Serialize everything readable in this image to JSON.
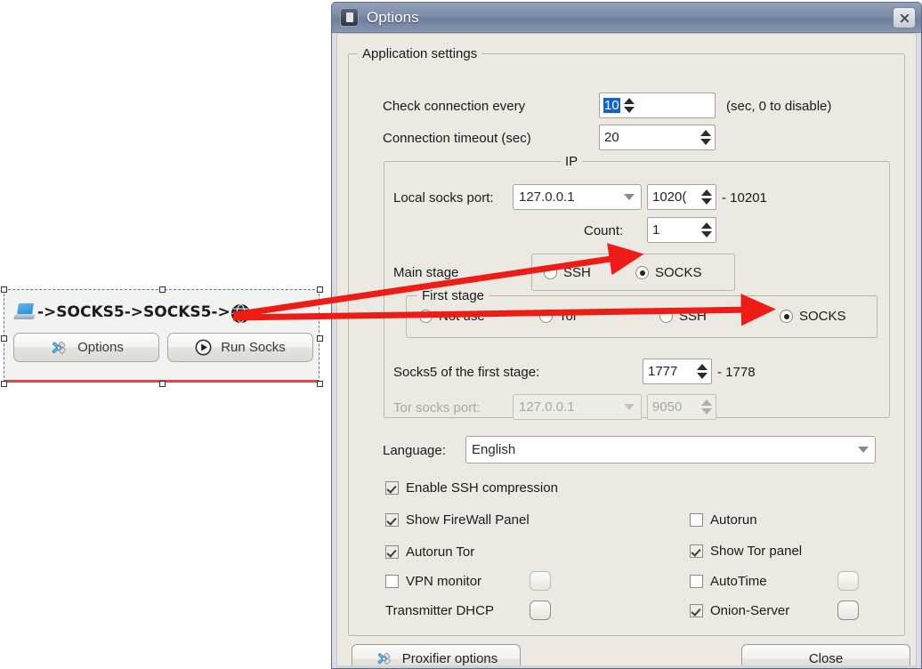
{
  "widget": {
    "chain_text": "->SOCKS5->SOCKS5->",
    "pc_icon": "computer-icon",
    "globe_icon": "globe-icon",
    "options_label": "Options",
    "options_icon": "tools-icon",
    "run_label": "Run Socks",
    "run_icon": "play-icon"
  },
  "dialog": {
    "title": "Options",
    "title_icon": "app-icon",
    "close_icon": "close-icon",
    "group_legend": "Application settings",
    "check_connection_label": "Check connection every",
    "check_connection_value": "10",
    "check_connection_hint": "(sec, 0 to disable)",
    "connection_timeout_label": "Connection timeout (sec)",
    "connection_timeout_value": "20",
    "ip_group": {
      "legend": "IP",
      "local_socks_label": "Local socks port:",
      "local_socks_ip": "127.0.0.1",
      "port_value": "1020(",
      "port_range_suffix": "- 10201",
      "count_label": "Count:",
      "count_value": "1"
    },
    "main_stage": {
      "label": "Main stage",
      "options": [
        {
          "label": "SSH",
          "selected": false
        },
        {
          "label": "SOCKS",
          "selected": true
        }
      ]
    },
    "first_stage": {
      "legend": "First stage",
      "options": [
        {
          "label": "Not use",
          "selected": false
        },
        {
          "label": "Tor",
          "selected": false
        },
        {
          "label": "SSH",
          "selected": false
        },
        {
          "label": "SOCKS",
          "selected": true
        }
      ]
    },
    "socks5_first_stage": {
      "label": "Socks5 of the first stage:",
      "value": "1777",
      "range_suffix": "- 1778"
    },
    "tor_socks": {
      "label": "Tor socks port:",
      "ip": "127.0.0.1",
      "port": "9050",
      "disabled": true
    },
    "language": {
      "label": "Language:",
      "value": "English"
    },
    "checkboxes_left": [
      {
        "label": "Enable SSH compression",
        "checked": true,
        "has_box": true,
        "has_mini": false
      },
      {
        "label": "Show FireWall Panel",
        "checked": true,
        "has_box": true,
        "has_mini": false
      },
      {
        "label": "Autorun Tor",
        "checked": true,
        "has_box": true,
        "has_mini": false
      },
      {
        "label": "VPN monitor",
        "checked": false,
        "has_box": true,
        "has_mini": true
      },
      {
        "label": "Transmitter DHCP",
        "checked": false,
        "has_box": false,
        "has_mini": true
      }
    ],
    "checkboxes_right": [
      {
        "label": "Autorun",
        "checked": false,
        "has_box": true,
        "has_mini": false
      },
      {
        "label": "Show Tor panel",
        "checked": true,
        "has_box": true,
        "has_mini": false
      },
      {
        "label": "AutoTime",
        "checked": false,
        "has_box": true,
        "has_mini": true
      },
      {
        "label": "Onion-Server",
        "checked": true,
        "has_box": true,
        "has_mini": true
      }
    ],
    "proxifier_label": "Proxifier options",
    "proxifier_icon": "tools-icon",
    "close_label": "Close"
  },
  "colors": {
    "annotation_arrow": "#ee1c16",
    "titlebar": "#7d8ca8",
    "dialog_bg": "#ebe9e2",
    "selection_blue": "#1064c8",
    "selection_border": "#4a7ebb",
    "widget_redline": "#f0413c"
  }
}
